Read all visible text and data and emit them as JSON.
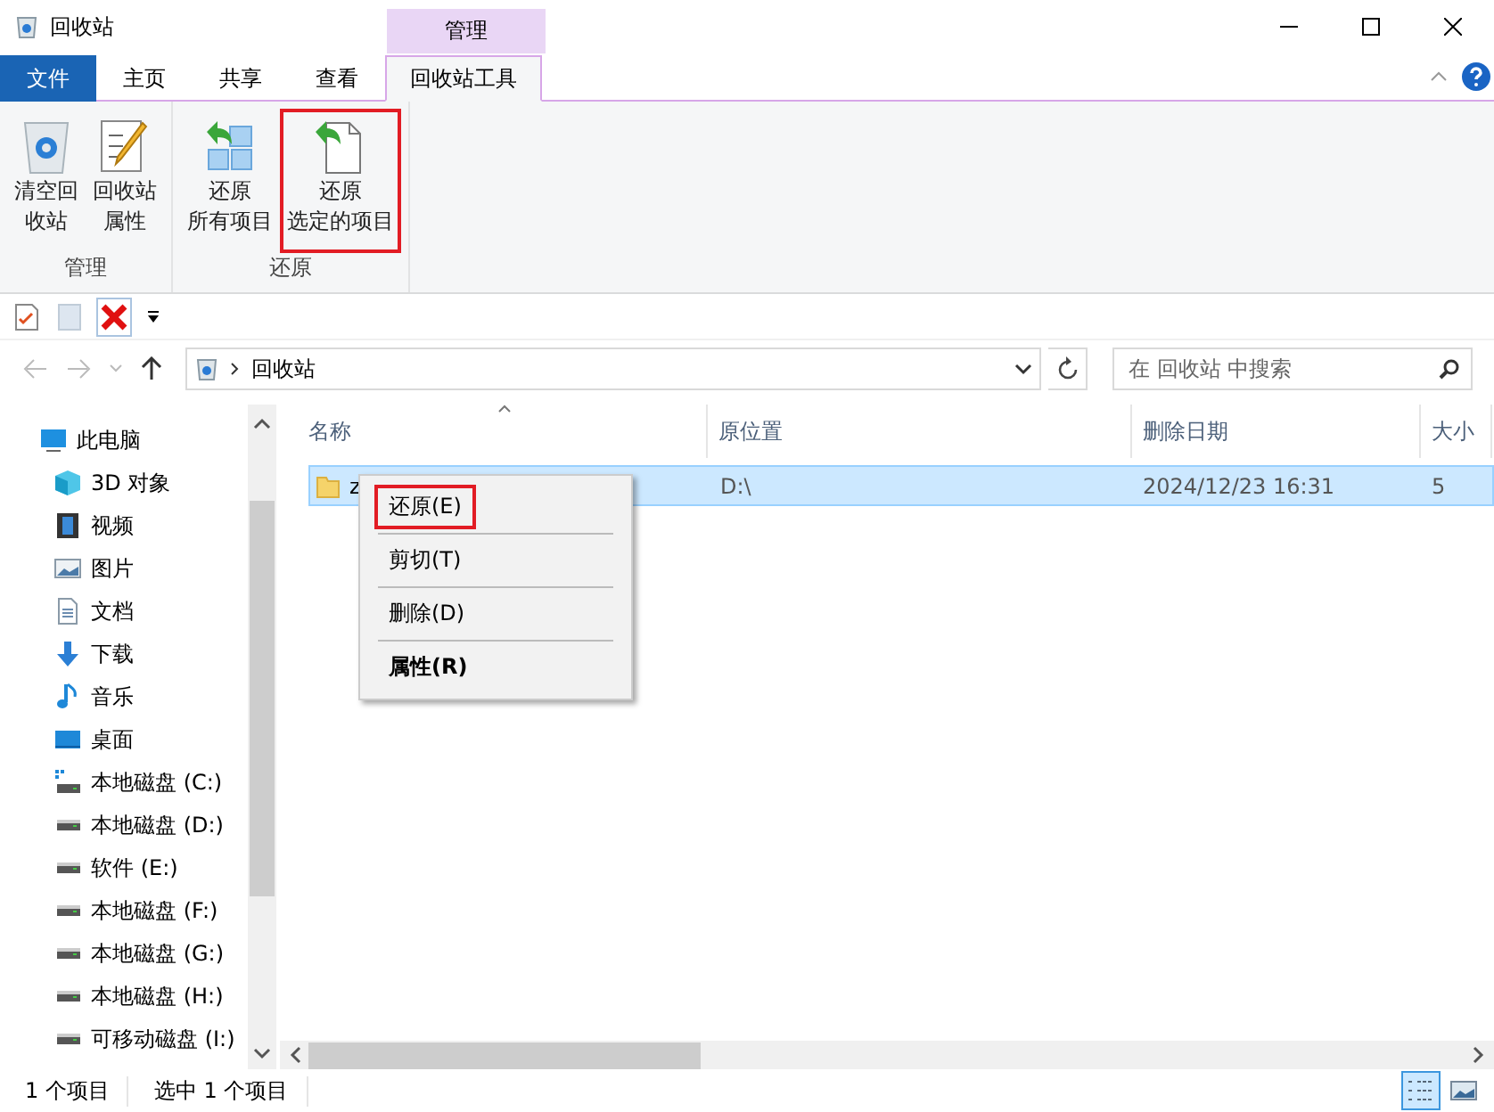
{
  "window": {
    "title": "回收站"
  },
  "ribbon": {
    "context_header": "管理",
    "tabs": [
      {
        "label": "文件",
        "kind": "file",
        "selected": false
      },
      {
        "label": "主页",
        "kind": "normal",
        "selected": false
      },
      {
        "label": "共享",
        "kind": "normal",
        "selected": false
      },
      {
        "label": "查看",
        "kind": "normal",
        "selected": false
      },
      {
        "label": "回收站工具",
        "kind": "context",
        "selected": true
      }
    ],
    "groups": [
      {
        "label": "管理",
        "buttons": [
          {
            "lines": [
              "清空回",
              "收站"
            ],
            "kind": "empty-bin",
            "highlighted": false
          },
          {
            "lines": [
              "回收站",
              "属性"
            ],
            "kind": "properties",
            "highlighted": false
          }
        ]
      },
      {
        "label": "还原",
        "buttons": [
          {
            "lines": [
              "还原",
              "所有项目"
            ],
            "kind": "restore-all",
            "highlighted": false
          },
          {
            "lines": [
              "还原",
              "选定的项目"
            ],
            "kind": "restore-selected",
            "highlighted": true
          }
        ]
      }
    ]
  },
  "address": {
    "path": "回收站",
    "search_placeholder": "在 回收站 中搜索"
  },
  "sidebar": {
    "items": [
      {
        "label": "此电脑",
        "kind": "pc"
      },
      {
        "label": "3D 对象",
        "kind": "cube"
      },
      {
        "label": "视频",
        "kind": "video"
      },
      {
        "label": "图片",
        "kind": "pictures"
      },
      {
        "label": "文档",
        "kind": "docs"
      },
      {
        "label": "下载",
        "kind": "download"
      },
      {
        "label": "音乐",
        "kind": "music"
      },
      {
        "label": "桌面",
        "kind": "desktop"
      },
      {
        "label": "本地磁盘 (C:)",
        "kind": "system-drive"
      },
      {
        "label": "本地磁盘 (D:)",
        "kind": "drive"
      },
      {
        "label": "软件 (E:)",
        "kind": "drive"
      },
      {
        "label": "本地磁盘 (F:)",
        "kind": "drive"
      },
      {
        "label": "本地磁盘 (G:)",
        "kind": "drive"
      },
      {
        "label": "本地磁盘 (H:)",
        "kind": "drive"
      },
      {
        "label": "可移动磁盘 (I:)",
        "kind": "drive"
      }
    ]
  },
  "table": {
    "columns": [
      "名称",
      "原位置",
      "删除日期",
      "大小"
    ],
    "rows": [
      {
        "cells": [
          "z",
          "D:\\",
          "2024/12/23 16:31",
          "5"
        ],
        "selected": true
      }
    ]
  },
  "context_menu": {
    "items": [
      {
        "label": "还原(E)",
        "bold": false,
        "highlighted": true
      },
      {
        "label": "剪切(T)",
        "bold": false,
        "highlighted": false
      },
      {
        "label": "删除(D)",
        "bold": false,
        "highlighted": false
      },
      {
        "label": "属性(R)",
        "bold": true,
        "highlighted": false
      }
    ]
  },
  "status_bar": {
    "texts": [
      "1 个项目",
      "选中 1 个项目"
    ],
    "view_buttons": [
      {
        "kind": "details",
        "selected": true
      },
      {
        "kind": "large-icons",
        "selected": false
      }
    ]
  }
}
